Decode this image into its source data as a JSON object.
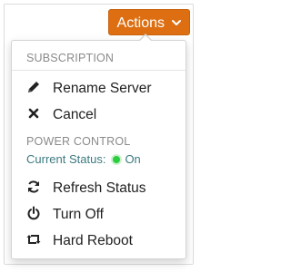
{
  "actions_button": {
    "label": "Actions",
    "icon": "chevron-down-icon"
  },
  "colors": {
    "accent": "#dd6f12",
    "section_header": "#8a8a8a",
    "status_text": "#3d7a80",
    "status_on": "#2ecc40"
  },
  "menu": {
    "subscription": {
      "header": "SUBSCRIPTION",
      "items": [
        {
          "label": "Rename Server",
          "icon": "pencil-icon"
        },
        {
          "label": "Cancel",
          "icon": "x-icon"
        }
      ]
    },
    "power_control": {
      "header": "POWER CONTROL",
      "status_label": "Current Status:",
      "status_value": "On",
      "items": [
        {
          "label": "Refresh Status",
          "icon": "refresh-icon"
        },
        {
          "label": "Turn Off",
          "icon": "power-icon"
        },
        {
          "label": "Hard Reboot",
          "icon": "retweet-icon"
        }
      ]
    }
  }
}
